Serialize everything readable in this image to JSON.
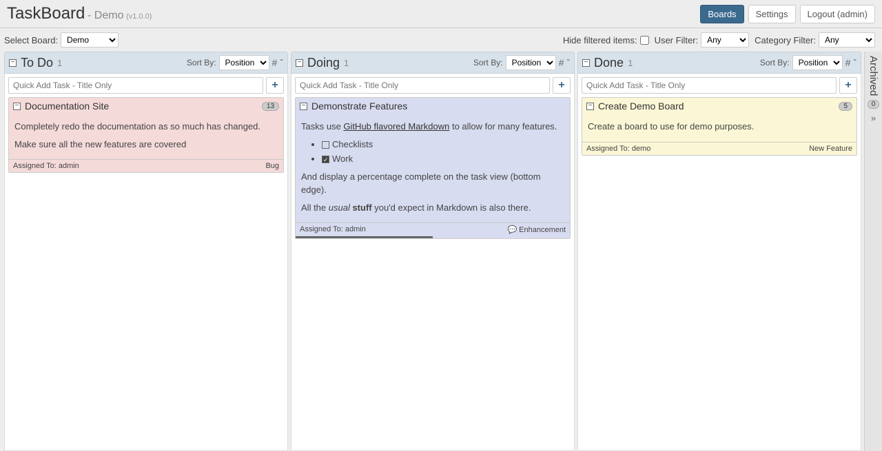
{
  "header": {
    "app_name": "TaskBoard",
    "subtitle": "- Demo",
    "version": "(v1.0.0)",
    "buttons": {
      "boards": "Boards",
      "settings": "Settings",
      "logout": "Logout (admin)"
    }
  },
  "filters": {
    "select_board_label": "Select Board:",
    "selected_board": "Demo",
    "hide_filtered_label": "Hide filtered items:",
    "user_filter_label": "User Filter:",
    "user_filter_value": "Any",
    "category_filter_label": "Category Filter:",
    "category_filter_value": "Any"
  },
  "quickadd_placeholder": "Quick Add Task - Title Only",
  "sort_label": "Sort By:",
  "sort_value": "Position",
  "columns": {
    "todo": {
      "title": "To Do",
      "count": "1"
    },
    "doing": {
      "title": "Doing",
      "count": "1"
    },
    "done": {
      "title": "Done",
      "count": "1"
    }
  },
  "archived": {
    "label": "Archived",
    "count": "0"
  },
  "cards": {
    "doc": {
      "title": "Documentation Site",
      "points": "13",
      "p1": "Completely redo the documentation as so much has changed.",
      "p2": "Make sure all the new features are covered",
      "assigned": "Assigned To: admin",
      "category": "Bug"
    },
    "demo": {
      "title": "Demonstrate Features",
      "line_a": "Tasks use ",
      "gfm": "GitHub flavored Markdown",
      "line_b": " to allow for many features.",
      "checklist_item": "Checklists",
      "work_item": "Work",
      "pct_line": "And display a percentage complete on the task view (bottom edge).",
      "usual_a": "All the ",
      "usual_i": "usual",
      "usual_s": " stuff",
      "usual_b": " you'd expect in Markdown is also there.",
      "assigned": "Assigned To: admin",
      "category": "Enhancement",
      "progress_pct": 50
    },
    "create": {
      "title": "Create Demo Board",
      "points": "5",
      "p1": "Create a board to use for demo purposes.",
      "assigned": "Assigned To: demo",
      "category": "New Feature"
    }
  }
}
